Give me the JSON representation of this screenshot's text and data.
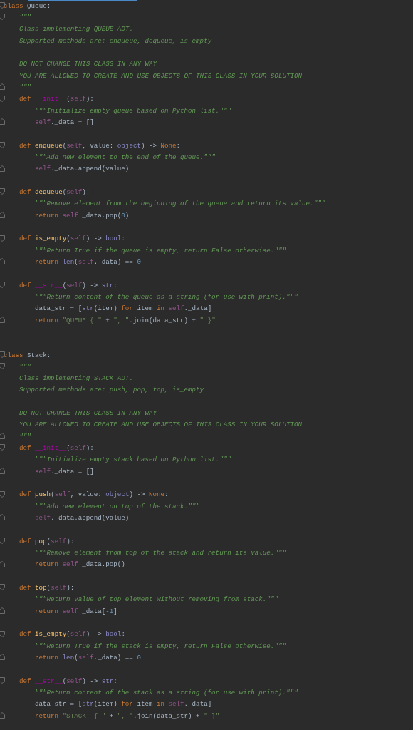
{
  "editor": {
    "classes": [
      {
        "header": {
          "fold_start": true,
          "tokens": [
            {
              "text": "class",
              "kind": "kw"
            },
            {
              "text": " Queue:",
              "kind": "p"
            }
          ]
        },
        "docstring": [
          [
            {
              "fold_start": true,
              "tokens": [
                {
                  "text": "\"\"\"",
                  "kind": "doc"
                }
              ]
            },
            {
              "tokens": [
                {
                  "text": "Class implementing QUEUE ADT.",
                  "kind": "doc"
                }
              ]
            },
            {
              "tokens": [
                {
                  "text": "Supported methods are: enqueue, dequeue, is_empty",
                  "kind": "doc"
                }
              ]
            }
          ],
          [
            {
              "tokens": [
                {
                  "text": "DO NOT CHANGE THIS CLASS IN ANY WAY",
                  "kind": "doc"
                }
              ]
            },
            {
              "tokens": [
                {
                  "text": "YOU ARE ALLOWED TO CREATE AND USE OBJECTS OF THIS CLASS IN YOUR SOLUTION",
                  "kind": "doc"
                }
              ]
            },
            {
              "fold_end": true,
              "tokens": [
                {
                  "text": "\"\"\"",
                  "kind": "doc"
                }
              ]
            }
          ]
        ],
        "methods": [
          {
            "header": {
              "fold_start": true,
              "tokens": [
                {
                  "text": "def",
                  "kind": "kw"
                },
                {
                  "text": " __init__",
                  "kind": "mg"
                },
                {
                  "text": "(",
                  "kind": "p"
                },
                {
                  "text": "self",
                  "kind": "sf"
                },
                {
                  "text": "):",
                  "kind": "p"
                }
              ]
            },
            "body": [
              {
                "tokens": [
                  {
                    "text": "\"\"\"Initialize empty queue based on Python list.\"\"\"",
                    "kind": "doc"
                  }
                ]
              },
              {
                "fold_end": true,
                "tokens": [
                  {
                    "text": "self",
                    "kind": "sf"
                  },
                  {
                    "text": "._data = []",
                    "kind": "p"
                  }
                ]
              }
            ]
          },
          {
            "header": {
              "fold_start": true,
              "tokens": [
                {
                  "text": "def",
                  "kind": "kw"
                },
                {
                  "text": " enqueue",
                  "kind": "fn"
                },
                {
                  "text": "(",
                  "kind": "p"
                },
                {
                  "text": "self",
                  "kind": "sf"
                },
                {
                  "text": ", value: ",
                  "kind": "p"
                },
                {
                  "text": "object",
                  "kind": "bi"
                },
                {
                  "text": ") -> ",
                  "kind": "p"
                },
                {
                  "text": "None",
                  "kind": "kw"
                },
                {
                  "text": ":",
                  "kind": "p"
                }
              ]
            },
            "body": [
              {
                "tokens": [
                  {
                    "text": "\"\"\"Add new element to the end of the queue.\"\"\"",
                    "kind": "doc"
                  }
                ]
              },
              {
                "fold_end": true,
                "tokens": [
                  {
                    "text": "self",
                    "kind": "sf"
                  },
                  {
                    "text": "._data.append(value)",
                    "kind": "p"
                  }
                ]
              }
            ]
          },
          {
            "header": {
              "fold_start": true,
              "tokens": [
                {
                  "text": "def",
                  "kind": "kw"
                },
                {
                  "text": " dequeue",
                  "kind": "fn"
                },
                {
                  "text": "(",
                  "kind": "p"
                },
                {
                  "text": "self",
                  "kind": "sf"
                },
                {
                  "text": "):",
                  "kind": "p"
                }
              ]
            },
            "body": [
              {
                "tokens": [
                  {
                    "text": "\"\"\"Remove element from the beginning of the queue and return its value.\"\"\"",
                    "kind": "doc"
                  }
                ]
              },
              {
                "fold_end": true,
                "tokens": [
                  {
                    "text": "return",
                    "kind": "kw"
                  },
                  {
                    "text": " self",
                    "kind": "sf"
                  },
                  {
                    "text": "._data.pop(",
                    "kind": "p"
                  },
                  {
                    "text": "0",
                    "kind": "num"
                  },
                  {
                    "text": ")",
                    "kind": "p"
                  }
                ]
              }
            ]
          },
          {
            "header": {
              "fold_start": true,
              "tokens": [
                {
                  "text": "def",
                  "kind": "kw"
                },
                {
                  "text": " is_empty",
                  "kind": "fn"
                },
                {
                  "text": "(",
                  "kind": "p"
                },
                {
                  "text": "self",
                  "kind": "sf"
                },
                {
                  "text": ") -> ",
                  "kind": "p"
                },
                {
                  "text": "bool",
                  "kind": "bi"
                },
                {
                  "text": ":",
                  "kind": "p"
                }
              ]
            },
            "body": [
              {
                "tokens": [
                  {
                    "text": "\"\"\"Return True if the queue is empty, return False otherwise.\"\"\"",
                    "kind": "doc"
                  }
                ]
              },
              {
                "fold_end": true,
                "tokens": [
                  {
                    "text": "return",
                    "kind": "kw"
                  },
                  {
                    "text": " len",
                    "kind": "bi"
                  },
                  {
                    "text": "(",
                    "kind": "p"
                  },
                  {
                    "text": "self",
                    "kind": "sf"
                  },
                  {
                    "text": "._data) == ",
                    "kind": "p"
                  },
                  {
                    "text": "0",
                    "kind": "num"
                  }
                ]
              }
            ]
          },
          {
            "header": {
              "fold_start": true,
              "tokens": [
                {
                  "text": "def",
                  "kind": "kw"
                },
                {
                  "text": " __str__",
                  "kind": "mg"
                },
                {
                  "text": "(",
                  "kind": "p"
                },
                {
                  "text": "self",
                  "kind": "sf"
                },
                {
                  "text": ") -> ",
                  "kind": "p"
                },
                {
                  "text": "str",
                  "kind": "bi"
                },
                {
                  "text": ":",
                  "kind": "p"
                }
              ]
            },
            "body": [
              {
                "tokens": [
                  {
                    "text": "\"\"\"Return content of the queue as a string (for use with print).\"\"\"",
                    "kind": "doc"
                  }
                ]
              },
              {
                "tokens": [
                  {
                    "text": "data_str = [",
                    "kind": "p"
                  },
                  {
                    "text": "str",
                    "kind": "bi"
                  },
                  {
                    "text": "(item) ",
                    "kind": "p"
                  },
                  {
                    "text": "for",
                    "kind": "kw"
                  },
                  {
                    "text": " item ",
                    "kind": "p"
                  },
                  {
                    "text": "in",
                    "kind": "kw"
                  },
                  {
                    "text": " self",
                    "kind": "sf"
                  },
                  {
                    "text": "._data]",
                    "kind": "p"
                  }
                ]
              },
              {
                "fold_end": true,
                "tokens": [
                  {
                    "text": "return",
                    "kind": "kw"
                  },
                  {
                    "text": " \"QUEUE { \"",
                    "kind": "str"
                  },
                  {
                    "text": " + ",
                    "kind": "p"
                  },
                  {
                    "text": "\", \"",
                    "kind": "str"
                  },
                  {
                    "text": ".join(data_str) + ",
                    "kind": "p"
                  },
                  {
                    "text": "\" }\"",
                    "kind": "str"
                  }
                ]
              }
            ]
          }
        ]
      },
      {
        "header": {
          "fold_start": true,
          "tokens": [
            {
              "text": "class",
              "kind": "kw"
            },
            {
              "text": " Stack:",
              "kind": "p"
            }
          ]
        },
        "docstring": [
          [
            {
              "fold_start": true,
              "tokens": [
                {
                  "text": "\"\"\"",
                  "kind": "doc"
                }
              ]
            },
            {
              "tokens": [
                {
                  "text": "Class implementing STACK ADT.",
                  "kind": "doc"
                }
              ]
            },
            {
              "tokens": [
                {
                  "text": "Supported methods are: push, pop, top, is_empty",
                  "kind": "doc"
                }
              ]
            }
          ],
          [
            {
              "tokens": [
                {
                  "text": "DO NOT CHANGE THIS CLASS IN ANY WAY",
                  "kind": "doc"
                }
              ]
            },
            {
              "tokens": [
                {
                  "text": "YOU ARE ALLOWED TO CREATE AND USE OBJECTS OF THIS CLASS IN YOUR SOLUTION",
                  "kind": "doc"
                }
              ]
            },
            {
              "fold_end": true,
              "tokens": [
                {
                  "text": "\"\"\"",
                  "kind": "doc"
                }
              ]
            }
          ]
        ],
        "methods": [
          {
            "header": {
              "fold_start": true,
              "tokens": [
                {
                  "text": "def",
                  "kind": "kw"
                },
                {
                  "text": " __init__",
                  "kind": "mg"
                },
                {
                  "text": "(",
                  "kind": "p"
                },
                {
                  "text": "self",
                  "kind": "sf"
                },
                {
                  "text": "):",
                  "kind": "p"
                }
              ]
            },
            "body": [
              {
                "tokens": [
                  {
                    "text": "\"\"\"Initialize empty stack based on Python list.\"\"\"",
                    "kind": "doc"
                  }
                ]
              },
              {
                "fold_end": true,
                "tokens": [
                  {
                    "text": "self",
                    "kind": "sf"
                  },
                  {
                    "text": "._data = []",
                    "kind": "p"
                  }
                ]
              }
            ]
          },
          {
            "header": {
              "fold_start": true,
              "tokens": [
                {
                  "text": "def",
                  "kind": "kw"
                },
                {
                  "text": " push",
                  "kind": "fn"
                },
                {
                  "text": "(",
                  "kind": "p"
                },
                {
                  "text": "self",
                  "kind": "sf"
                },
                {
                  "text": ", value: ",
                  "kind": "p"
                },
                {
                  "text": "object",
                  "kind": "bi"
                },
                {
                  "text": ") -> ",
                  "kind": "p"
                },
                {
                  "text": "None",
                  "kind": "kw"
                },
                {
                  "text": ":",
                  "kind": "p"
                }
              ]
            },
            "body": [
              {
                "tokens": [
                  {
                    "text": "\"\"\"Add new element on top of the stack.\"\"\"",
                    "kind": "doc"
                  }
                ]
              },
              {
                "fold_end": true,
                "tokens": [
                  {
                    "text": "self",
                    "kind": "sf"
                  },
                  {
                    "text": "._data.append(value)",
                    "kind": "p"
                  }
                ]
              }
            ]
          },
          {
            "header": {
              "fold_start": true,
              "tokens": [
                {
                  "text": "def",
                  "kind": "kw"
                },
                {
                  "text": " pop",
                  "kind": "fn"
                },
                {
                  "text": "(",
                  "kind": "p"
                },
                {
                  "text": "self",
                  "kind": "sf"
                },
                {
                  "text": "):",
                  "kind": "p"
                }
              ]
            },
            "body": [
              {
                "tokens": [
                  {
                    "text": "\"\"\"Remove element from top of the stack and return its value.\"\"\"",
                    "kind": "doc"
                  }
                ]
              },
              {
                "fold_end": true,
                "tokens": [
                  {
                    "text": "return",
                    "kind": "kw"
                  },
                  {
                    "text": " self",
                    "kind": "sf"
                  },
                  {
                    "text": "._data.pop()",
                    "kind": "p"
                  }
                ]
              }
            ]
          },
          {
            "header": {
              "fold_start": true,
              "tokens": [
                {
                  "text": "def",
                  "kind": "kw"
                },
                {
                  "text": " top",
                  "kind": "fn"
                },
                {
                  "text": "(",
                  "kind": "p"
                },
                {
                  "text": "self",
                  "kind": "sf"
                },
                {
                  "text": "):",
                  "kind": "p"
                }
              ]
            },
            "body": [
              {
                "tokens": [
                  {
                    "text": "\"\"\"Return value of top element without removing from stack.\"\"\"",
                    "kind": "doc"
                  }
                ]
              },
              {
                "fold_end": true,
                "tokens": [
                  {
                    "text": "return",
                    "kind": "kw"
                  },
                  {
                    "text": " self",
                    "kind": "sf"
                  },
                  {
                    "text": "._data[",
                    "kind": "p"
                  },
                  {
                    "text": "-1",
                    "kind": "num"
                  },
                  {
                    "text": "]",
                    "kind": "p"
                  }
                ]
              }
            ]
          },
          {
            "header": {
              "fold_start": true,
              "tokens": [
                {
                  "text": "def",
                  "kind": "kw"
                },
                {
                  "text": " is_empty",
                  "kind": "fn"
                },
                {
                  "text": "(",
                  "kind": "p"
                },
                {
                  "text": "self",
                  "kind": "sf"
                },
                {
                  "text": ") -> ",
                  "kind": "p"
                },
                {
                  "text": "bool",
                  "kind": "bi"
                },
                {
                  "text": ":",
                  "kind": "p"
                }
              ]
            },
            "body": [
              {
                "tokens": [
                  {
                    "text": "\"\"\"Return True if the stack is empty, return False otherwise.\"\"\"",
                    "kind": "doc"
                  }
                ]
              },
              {
                "fold_end": true,
                "tokens": [
                  {
                    "text": "return",
                    "kind": "kw"
                  },
                  {
                    "text": " len",
                    "kind": "bi"
                  },
                  {
                    "text": "(",
                    "kind": "p"
                  },
                  {
                    "text": "self",
                    "kind": "sf"
                  },
                  {
                    "text": "._data) == ",
                    "kind": "p"
                  },
                  {
                    "text": "0",
                    "kind": "num"
                  }
                ]
              }
            ]
          },
          {
            "header": {
              "fold_start": true,
              "tokens": [
                {
                  "text": "def",
                  "kind": "kw"
                },
                {
                  "text": " __str__",
                  "kind": "mg"
                },
                {
                  "text": "(",
                  "kind": "p"
                },
                {
                  "text": "self",
                  "kind": "sf"
                },
                {
                  "text": ") -> ",
                  "kind": "p"
                },
                {
                  "text": "str",
                  "kind": "bi"
                },
                {
                  "text": ":",
                  "kind": "p"
                }
              ]
            },
            "body": [
              {
                "tokens": [
                  {
                    "text": "\"\"\"Return content of the stack as a string (for use with print).\"\"\"",
                    "kind": "doc"
                  }
                ]
              },
              {
                "tokens": [
                  {
                    "text": "data_str = [",
                    "kind": "p"
                  },
                  {
                    "text": "str",
                    "kind": "bi"
                  },
                  {
                    "text": "(item) ",
                    "kind": "p"
                  },
                  {
                    "text": "for",
                    "kind": "kw"
                  },
                  {
                    "text": " item ",
                    "kind": "p"
                  },
                  {
                    "text": "in",
                    "kind": "kw"
                  },
                  {
                    "text": " self",
                    "kind": "sf"
                  },
                  {
                    "text": "._data]",
                    "kind": "p"
                  }
                ]
              },
              {
                "fold_end": true,
                "tokens": [
                  {
                    "text": "return",
                    "kind": "kw"
                  },
                  {
                    "text": " \"STACK: { \"",
                    "kind": "str"
                  },
                  {
                    "text": " + ",
                    "kind": "p"
                  },
                  {
                    "text": "\", \"",
                    "kind": "str"
                  },
                  {
                    "text": ".join(data_str) + ",
                    "kind": "p"
                  },
                  {
                    "text": "\" }\"",
                    "kind": "str"
                  }
                ]
              }
            ]
          }
        ]
      }
    ]
  }
}
